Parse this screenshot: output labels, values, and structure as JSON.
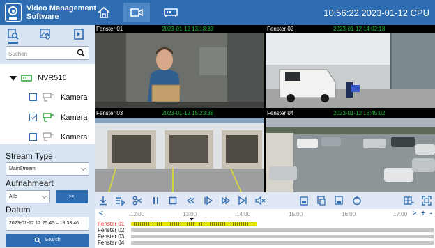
{
  "app": {
    "title": "Video Management Software",
    "title_line1": "Video Management",
    "title_line2": "Software",
    "clock": "10:56:22 2023-01-12 CPU",
    "accent_color": "#2f6db3",
    "active_nav": "video"
  },
  "nav": [
    {
      "icon": "home-icon"
    },
    {
      "icon": "camera-icon"
    },
    {
      "icon": "device-icon"
    }
  ],
  "sidebar": {
    "tabs": [
      {
        "icon": "device-search-icon",
        "active": true
      },
      {
        "icon": "image-search-icon",
        "active": false
      },
      {
        "icon": "export-icon",
        "active": false
      }
    ],
    "search": {
      "placeholder": "Suchen",
      "value": ""
    },
    "tree": {
      "nvr_label": "NVR516",
      "cameras": [
        {
          "label": "Kamera",
          "checked": false
        },
        {
          "label": "Kamera",
          "checked": true
        },
        {
          "label": "Kamera",
          "checked": false
        }
      ]
    },
    "stream_type": {
      "label": "Stream Type",
      "value": "MainStream"
    },
    "record_type": {
      "label": "Aufnahmeart",
      "value": "Alle",
      "button_label": ">>"
    },
    "date": {
      "label": "Datum",
      "value": "2023-01-12  12:25:45 – 18:33:46"
    },
    "search_button": "Search"
  },
  "windows": [
    {
      "name": "Fenster 01",
      "timestamp": "2023-01-12  13:18:33"
    },
    {
      "name": "Fenster 02",
      "timestamp": "2023-01-12  14:02:18"
    },
    {
      "name": "Fenster 03",
      "timestamp": "2023-01-12  15:23:38"
    },
    {
      "name": "Fenster 04",
      "timestamp": "2023-01-12  16:45:02"
    }
  ],
  "playback_controls": [
    "download-icon",
    "list-play-icon",
    "cut-icon",
    "pause-icon",
    "stop-icon",
    "rewind-icon",
    "frame-step-icon",
    "fast-forward-icon",
    "next-icon",
    "mute-icon",
    "snapshot-icon",
    "copy-icon",
    "clip-icon",
    "refresh-icon",
    "layout-grid-icon",
    "fullscreen-icon"
  ],
  "timeline": {
    "nav_left": "<",
    "zoom_controls": "> + -",
    "ticks": [
      "12:00",
      "13:00",
      "14:00",
      "15:00",
      "16:00",
      "17:00"
    ],
    "tracks": [
      {
        "label": "Fenster 01",
        "active": true,
        "label_color": "#e0201b"
      },
      {
        "label": "Fenster 02",
        "active": false
      },
      {
        "label": "Fenster 03",
        "active": false
      },
      {
        "label": "Fenster 04",
        "active": false
      }
    ],
    "recording_color": "#e8e400"
  }
}
